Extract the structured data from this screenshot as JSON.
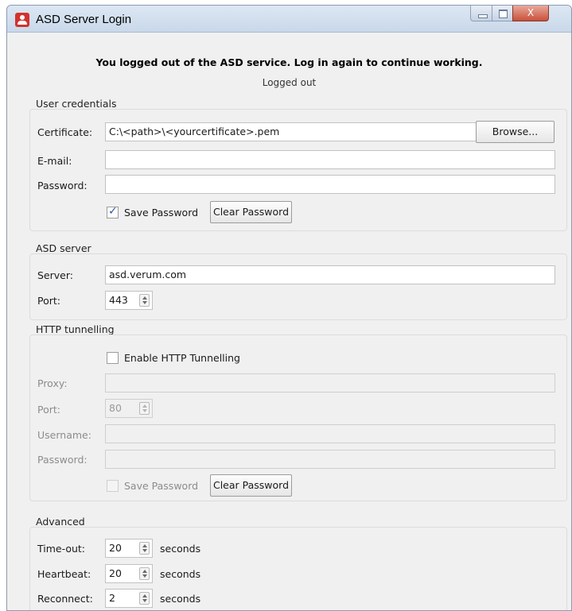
{
  "window": {
    "title": "ASD Server Login",
    "close_symbol": "X"
  },
  "header": {
    "message": "You logged out of the ASD service. Log in again to continue working.",
    "status": "Logged out"
  },
  "user_credentials": {
    "title": "User credentials",
    "certificate_label": "Certificate:",
    "certificate_value": "C:\\<path>\\<yourcertificate>.pem",
    "browse_label": "Browse...",
    "email_label": "E-mail:",
    "email_value": "",
    "password_label": "Password:",
    "password_value": "",
    "save_password_label": "Save Password",
    "save_password_checked": true,
    "clear_password_label": "Clear Password"
  },
  "asd_server": {
    "title": "ASD server",
    "server_label": "Server:",
    "server_value": "asd.verum.com",
    "port_label": "Port:",
    "port_value": "443"
  },
  "http_tunnelling": {
    "title": "HTTP tunnelling",
    "enable_label": "Enable HTTP Tunnelling",
    "enable_checked": false,
    "proxy_label": "Proxy:",
    "proxy_value": "",
    "port_label": "Port:",
    "port_value": "80",
    "username_label": "Username:",
    "username_value": "",
    "password_label": "Password:",
    "password_value": "",
    "save_password_label": "Save Password",
    "save_password_checked": false,
    "clear_password_label": "Clear Password"
  },
  "advanced": {
    "title": "Advanced",
    "timeout_label": "Time-out:",
    "timeout_value": "20",
    "heartbeat_label": "Heartbeat:",
    "heartbeat_value": "20",
    "reconnect_label": "Reconnect:",
    "reconnect_value": "2",
    "unit_label": "seconds"
  }
}
